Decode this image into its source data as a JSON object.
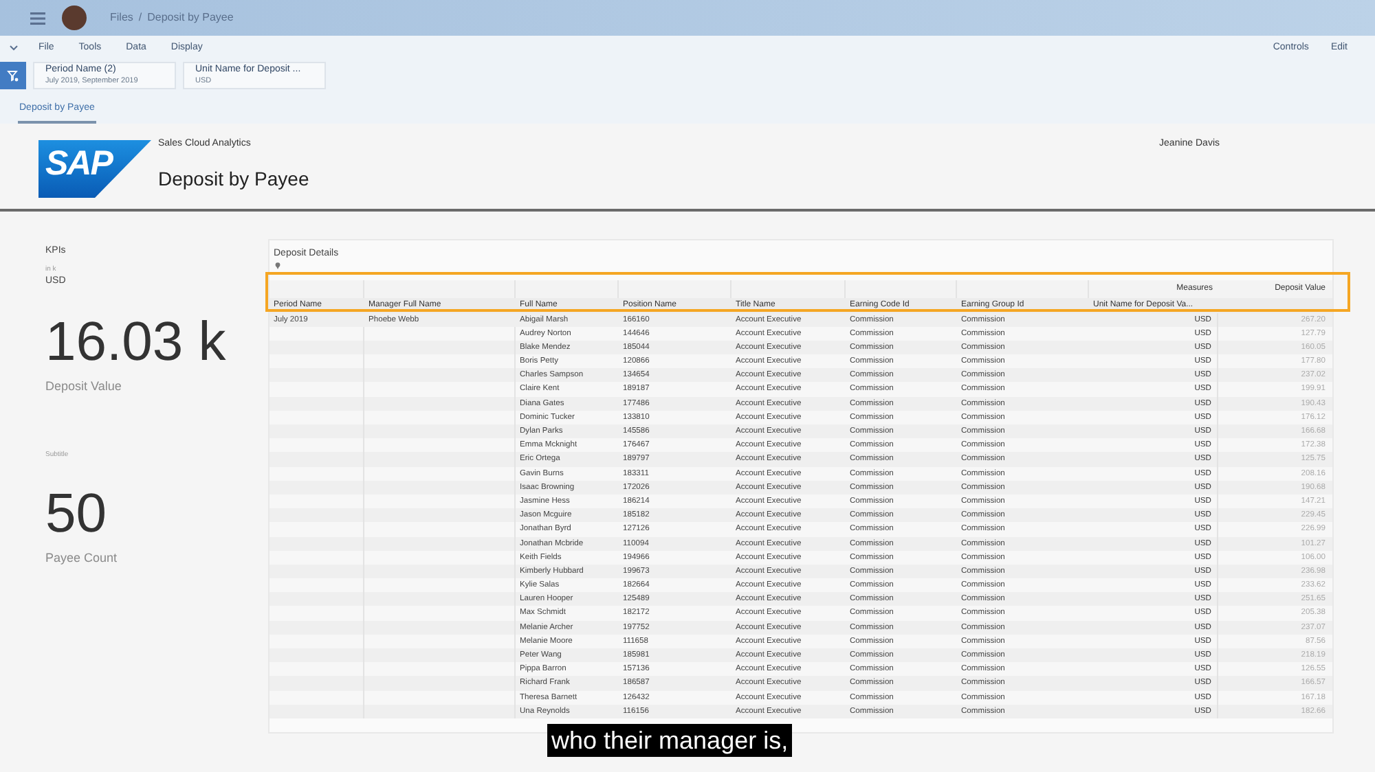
{
  "shell": {
    "breadcrumb": [
      "Files",
      "Deposit by Payee"
    ],
    "separator": "/"
  },
  "menu": {
    "items": [
      "File",
      "Tools",
      "Data",
      "Display"
    ],
    "right": [
      "Controls",
      "Edit"
    ]
  },
  "filters": [
    {
      "title": "Period Name (2)",
      "value": "July 2019, September 2019"
    },
    {
      "title": "Unit Name for Deposit ...",
      "value": "USD"
    }
  ],
  "tabs": [
    {
      "label": "Deposit by Payee",
      "selected": true
    }
  ],
  "header": {
    "subtitle": "Sales Cloud Analytics",
    "title": "Deposit by Payee",
    "user": "Jeanine Davis",
    "logo": "SAP"
  },
  "kpis": {
    "title": "KPIs",
    "items": [
      {
        "scale": "in k",
        "unit": "USD",
        "value": "16.03 k",
        "label": "Deposit Value"
      },
      {
        "scale": "Subtitle",
        "value": "50",
        "label": "Payee Count"
      }
    ]
  },
  "table": {
    "title": "Deposit Details",
    "measures_label": "Measures",
    "measure": "Deposit Value",
    "columns": [
      "Period Name",
      "Manager Full Name",
      "Full Name",
      "Position Name",
      "Title Name",
      "Earning Code Id",
      "Earning Group Id",
      "Unit Name for Deposit Va...",
      null
    ],
    "rows": [
      [
        "July 2019",
        "Phoebe Webb",
        "Abigail Marsh",
        "166160",
        "Account Executive",
        "Commission",
        "Commission",
        "USD",
        "267.20"
      ],
      [
        null,
        null,
        "Audrey Norton",
        "144646",
        "Account Executive",
        "Commission",
        "Commission",
        "USD",
        "127.79"
      ],
      [
        null,
        null,
        "Blake Mendez",
        "185044",
        "Account Executive",
        "Commission",
        "Commission",
        "USD",
        "160.05"
      ],
      [
        null,
        null,
        "Boris Petty",
        "120866",
        "Account Executive",
        "Commission",
        "Commission",
        "USD",
        "177.80"
      ],
      [
        null,
        null,
        "Charles Sampson",
        "134654",
        "Account Executive",
        "Commission",
        "Commission",
        "USD",
        "237.02"
      ],
      [
        null,
        null,
        "Claire Kent",
        "189187",
        "Account Executive",
        "Commission",
        "Commission",
        "USD",
        "199.91"
      ],
      [
        null,
        null,
        "Diana Gates",
        "177486",
        "Account Executive",
        "Commission",
        "Commission",
        "USD",
        "190.43"
      ],
      [
        null,
        null,
        "Dominic Tucker",
        "133810",
        "Account Executive",
        "Commission",
        "Commission",
        "USD",
        "176.12"
      ],
      [
        null,
        null,
        "Dylan Parks",
        "145586",
        "Account Executive",
        "Commission",
        "Commission",
        "USD",
        "166.68"
      ],
      [
        null,
        null,
        "Emma Mcknight",
        "176467",
        "Account Executive",
        "Commission",
        "Commission",
        "USD",
        "172.38"
      ],
      [
        null,
        null,
        "Eric Ortega",
        "189797",
        "Account Executive",
        "Commission",
        "Commission",
        "USD",
        "125.75"
      ],
      [
        null,
        null,
        "Gavin Burns",
        "183311",
        "Account Executive",
        "Commission",
        "Commission",
        "USD",
        "208.16"
      ],
      [
        null,
        null,
        "Isaac Browning",
        "172026",
        "Account Executive",
        "Commission",
        "Commission",
        "USD",
        "190.68"
      ],
      [
        null,
        null,
        "Jasmine Hess",
        "186214",
        "Account Executive",
        "Commission",
        "Commission",
        "USD",
        "147.21"
      ],
      [
        null,
        null,
        "Jason Mcguire",
        "185182",
        "Account Executive",
        "Commission",
        "Commission",
        "USD",
        "229.45"
      ],
      [
        null,
        null,
        "Jonathan Byrd",
        "127126",
        "Account Executive",
        "Commission",
        "Commission",
        "USD",
        "226.99"
      ],
      [
        null,
        null,
        "Jonathan Mcbride",
        "110094",
        "Account Executive",
        "Commission",
        "Commission",
        "USD",
        "101.27"
      ],
      [
        null,
        null,
        "Keith Fields",
        "194966",
        "Account Executive",
        "Commission",
        "Commission",
        "USD",
        "106.00"
      ],
      [
        null,
        null,
        "Kimberly Hubbard",
        "199673",
        "Account Executive",
        "Commission",
        "Commission",
        "USD",
        "236.98"
      ],
      [
        null,
        null,
        "Kylie Salas",
        "182664",
        "Account Executive",
        "Commission",
        "Commission",
        "USD",
        "233.62"
      ],
      [
        null,
        null,
        "Lauren Hooper",
        "125489",
        "Account Executive",
        "Commission",
        "Commission",
        "USD",
        "251.65"
      ],
      [
        null,
        null,
        "Max Schmidt",
        "182172",
        "Account Executive",
        "Commission",
        "Commission",
        "USD",
        "205.38"
      ],
      [
        null,
        null,
        "Melanie Archer",
        "197752",
        "Account Executive",
        "Commission",
        "Commission",
        "USD",
        "237.07"
      ],
      [
        null,
        null,
        "Melanie Moore",
        "111658",
        "Account Executive",
        "Commission",
        "Commission",
        "USD",
        "87.56"
      ],
      [
        null,
        null,
        "Peter Wang",
        "185981",
        "Account Executive",
        "Commission",
        "Commission",
        "USD",
        "218.19"
      ],
      [
        null,
        null,
        "Pippa Barron",
        "157136",
        "Account Executive",
        "Commission",
        "Commission",
        "USD",
        "126.55"
      ],
      [
        null,
        null,
        "Richard Frank",
        "186587",
        "Account Executive",
        "Commission",
        "Commission",
        "USD",
        "166.57"
      ],
      [
        null,
        null,
        "Theresa Barnett",
        "126432",
        "Account Executive",
        "Commission",
        "Commission",
        "USD",
        "167.18"
      ],
      [
        null,
        null,
        "Una Reynolds",
        "116156",
        "Account Executive",
        "Commission",
        "Commission",
        "USD",
        "182.66"
      ]
    ]
  },
  "caption": "who their manager is,"
}
